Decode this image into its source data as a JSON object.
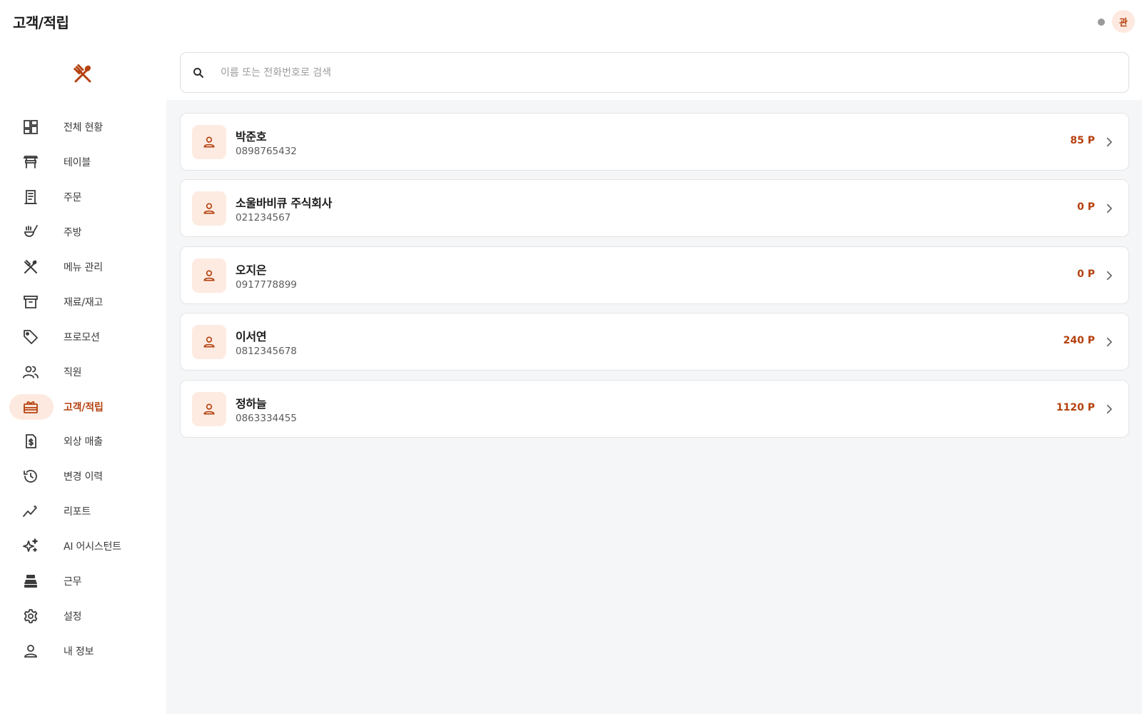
{
  "header": {
    "title": "고객/적립",
    "avatar_initial": "관"
  },
  "sidebar": {
    "items": [
      {
        "label": "전체 현황",
        "icon": "dashboard-icon"
      },
      {
        "label": "테이블",
        "icon": "table-icon"
      },
      {
        "label": "주문",
        "icon": "receipt-icon"
      },
      {
        "label": "주방",
        "icon": "kitchen-icon"
      },
      {
        "label": "메뉴 관리",
        "icon": "utensils-icon"
      },
      {
        "label": "재료/재고",
        "icon": "archive-icon"
      },
      {
        "label": "프로모션",
        "icon": "tag-icon"
      },
      {
        "label": "직원",
        "icon": "people-icon"
      },
      {
        "label": "고객/적립",
        "icon": "loyalty-icon",
        "active": true
      },
      {
        "label": "외상 매출",
        "icon": "invoice-dollar-icon"
      },
      {
        "label": "변경 이력",
        "icon": "history-icon"
      },
      {
        "label": "리포트",
        "icon": "trend-icon"
      },
      {
        "label": "AI 어시스턴트",
        "icon": "sparkles-icon"
      },
      {
        "label": "근무",
        "icon": "cash-register-icon"
      },
      {
        "label": "설정",
        "icon": "gear-icon"
      },
      {
        "label": "내 정보",
        "icon": "person-icon"
      }
    ]
  },
  "search": {
    "placeholder": "이름 또는 전화번호로 검색",
    "value": ""
  },
  "customers": [
    {
      "name": "박준호",
      "phone": "0898765432",
      "points": "85 P"
    },
    {
      "name": "소울바비큐 주식회사",
      "phone": "021234567",
      "points": "0 P"
    },
    {
      "name": "오지은",
      "phone": "0917778899",
      "points": "0 P"
    },
    {
      "name": "이서연",
      "phone": "0812345678",
      "points": "240 P"
    },
    {
      "name": "정하늘",
      "phone": "0863334455",
      "points": "1120 P"
    }
  ],
  "colors": {
    "accent": "#b5410f",
    "accent_soft": "#fde9df",
    "icon": "#3b3b3b",
    "background": "#f5f6f7"
  }
}
